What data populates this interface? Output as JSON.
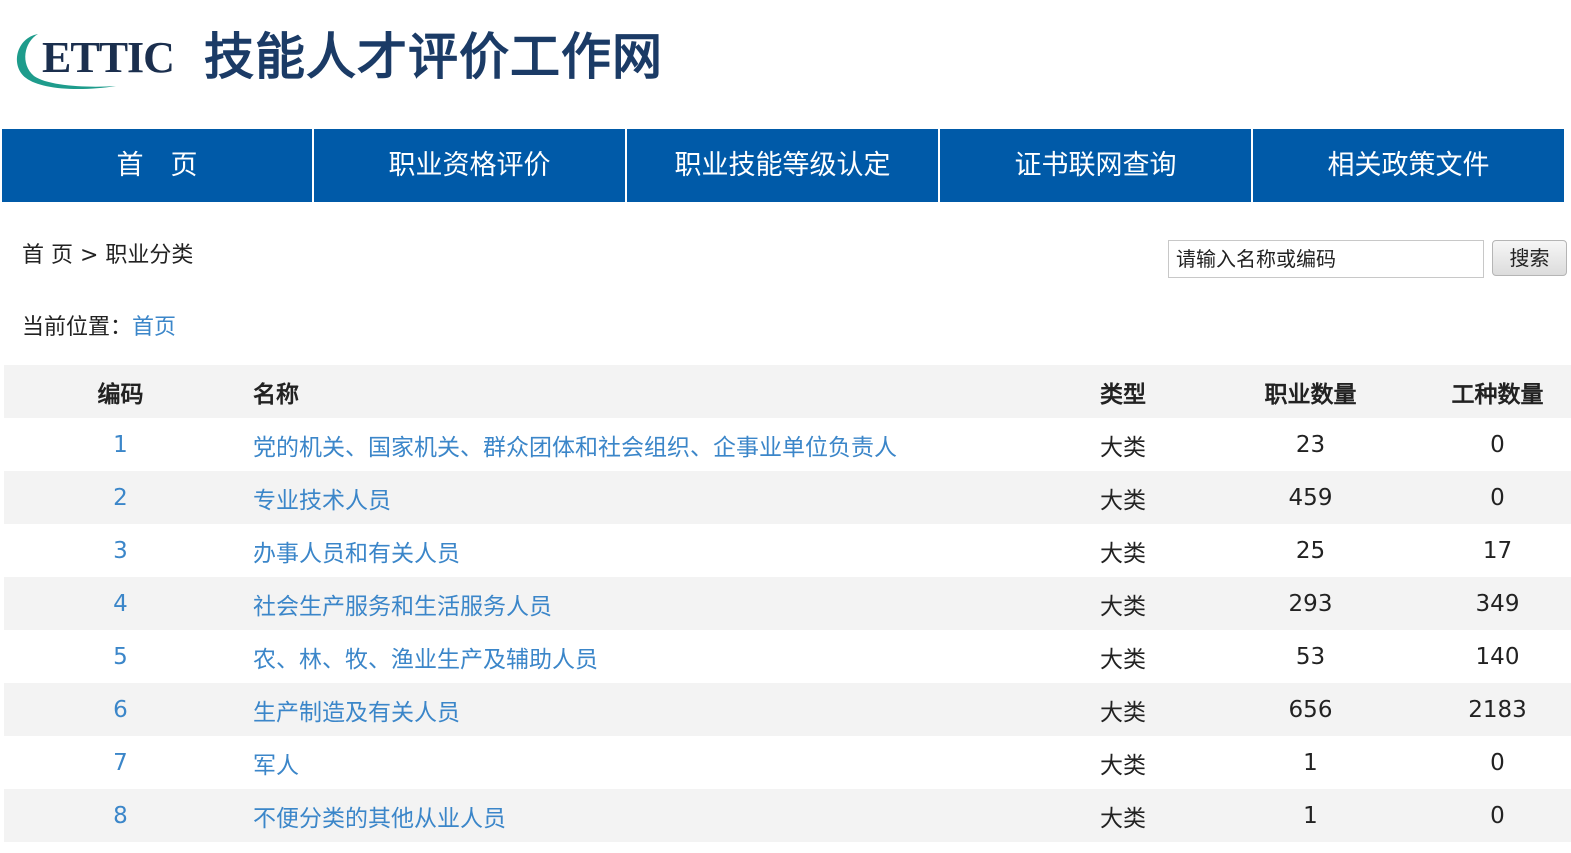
{
  "header": {
    "logo_text": "ETTIC",
    "site_title": "技能人才评价工作网"
  },
  "nav": {
    "items": [
      {
        "label": "首　页"
      },
      {
        "label": "职业资格评价"
      },
      {
        "label": "职业技能等级认定"
      },
      {
        "label": "证书联网查询"
      },
      {
        "label": "相关政策文件"
      }
    ]
  },
  "breadcrumb": {
    "text": "首  页 > 职业分类"
  },
  "search": {
    "placeholder": "请输入名称或编码",
    "button_label": "搜索"
  },
  "position": {
    "label": "当前位置：",
    "link": "首页"
  },
  "colors": {
    "nav_bg": "#005aa8",
    "link": "#3b86c9",
    "title": "#1b3b66",
    "logo_green": "#1e9c8c"
  },
  "table": {
    "headers": {
      "code": "编码",
      "name": "名称",
      "type": "类型",
      "occupations": "职业数量",
      "work_types": "工种数量"
    },
    "rows": [
      {
        "code": "1",
        "name": "党的机关、国家机关、群众团体和社会组织、企事业单位负责人",
        "type": "大类",
        "occupations": "23",
        "work_types": "0"
      },
      {
        "code": "2",
        "name": "专业技术人员",
        "type": "大类",
        "occupations": "459",
        "work_types": "0"
      },
      {
        "code": "3",
        "name": "办事人员和有关人员",
        "type": "大类",
        "occupations": "25",
        "work_types": "17"
      },
      {
        "code": "4",
        "name": "社会生产服务和生活服务人员",
        "type": "大类",
        "occupations": "293",
        "work_types": "349"
      },
      {
        "code": "5",
        "name": "农、林、牧、渔业生产及辅助人员",
        "type": "大类",
        "occupations": "53",
        "work_types": "140"
      },
      {
        "code": "6",
        "name": "生产制造及有关人员",
        "type": "大类",
        "occupations": "656",
        "work_types": "2183"
      },
      {
        "code": "7",
        "name": "军人",
        "type": "大类",
        "occupations": "1",
        "work_types": "0"
      },
      {
        "code": "8",
        "name": "不便分类的其他从业人员",
        "type": "大类",
        "occupations": "1",
        "work_types": "0"
      }
    ]
  }
}
